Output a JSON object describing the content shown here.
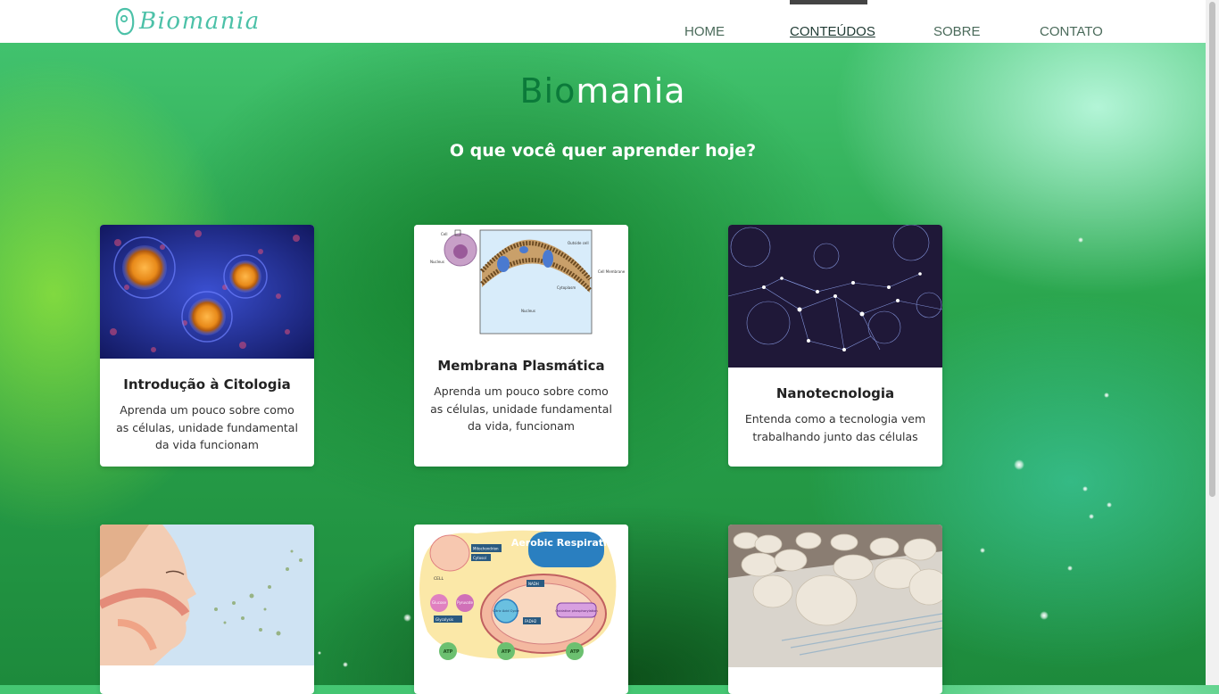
{
  "brand": {
    "logo_text": "Biomania",
    "accent": "#4cc1a8"
  },
  "nav": {
    "items": [
      {
        "label": "HOME",
        "active": false
      },
      {
        "label": "CONTEÚDOS",
        "active": true
      },
      {
        "label": "SOBRE",
        "active": false
      },
      {
        "label": "CONTATO",
        "active": false
      }
    ]
  },
  "hero": {
    "title_prefix": "Bio",
    "title_suffix": "mania",
    "subtitle": "O que você quer aprender hoje?"
  },
  "cards": [
    {
      "title": "Introdução à Citologia",
      "text": "Aprenda um pouco sobre como as células, unidade fundamental da vida funcionam",
      "image": "cells-microscope-image"
    },
    {
      "title": "Membrana Plasmática",
      "text": "Aprenda um pouco sobre como as células, unidade fundamental da vida, funcionam",
      "image": "cell-membrane-diagram",
      "diagram_labels": [
        "Cell",
        "Nucleus",
        "Outside cell",
        "Cell Membrane",
        "Cytoplasm",
        "Nucleus"
      ]
    },
    {
      "title": "Nanotecnologia",
      "text": "Entenda como a tecnologia vem trabalhando junto das células",
      "image": "nanotech-network-image"
    },
    {
      "title": "",
      "text": "",
      "image": "breathing-illustration"
    },
    {
      "title": "",
      "text": "",
      "image": "aerobic-respiration-diagram",
      "diagram_labels": [
        "Aerobic Respiration",
        "CELL",
        "Mitochondrion",
        "Cytosol",
        "Glucose",
        "Pyruvate",
        "Glycolysis",
        "Citric Acid Cycle",
        "Oxidative phosphorylation",
        "NADH",
        "FADH2",
        "ATP",
        "ATP",
        "ATP"
      ]
    },
    {
      "title": "",
      "text": "",
      "image": "bread-dough-image"
    }
  ]
}
